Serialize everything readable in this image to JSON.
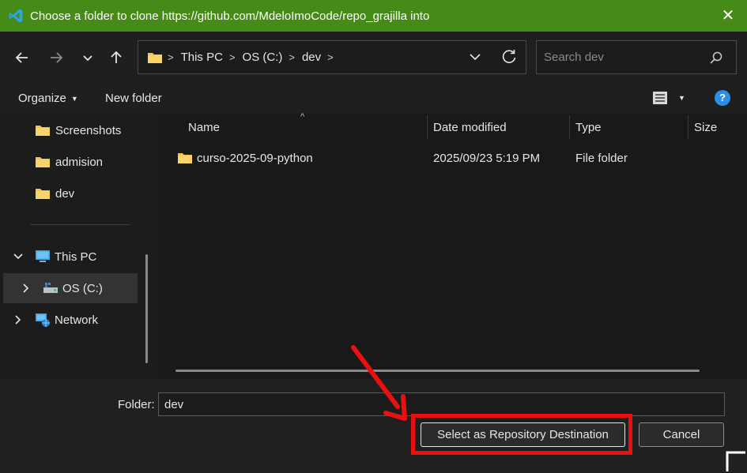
{
  "window": {
    "title": "Choose a folder to clone https://github.com/MdeloImoCode/repo_grajilla into",
    "titlebar_color": "#468a18",
    "app_icon": "vscode-icon",
    "close_glyph": "✕"
  },
  "nav": {
    "breadcrumbs": [
      "This PC",
      "OS (C:)",
      "dev"
    ],
    "search_placeholder": "Search dev"
  },
  "toolbar": {
    "organize_label": "Organize",
    "new_folder_label": "New folder"
  },
  "sidebar": {
    "quick_items": [
      {
        "label": "Screenshots",
        "icon": "folder-icon"
      },
      {
        "label": "admision",
        "icon": "folder-icon"
      },
      {
        "label": "dev",
        "icon": "folder-icon"
      }
    ],
    "this_pc_label": "This PC",
    "os_label": "OS (C:)",
    "network_label": "Network"
  },
  "columns": {
    "name": "Name",
    "date": "Date modified",
    "type": "Type",
    "size": "Size"
  },
  "files": [
    {
      "name": "curso-2025-09-python",
      "date": "2025/09/23 5:19 PM",
      "type": "File folder",
      "size": ""
    }
  ],
  "footer": {
    "folder_label": "Folder:",
    "folder_value": "dev",
    "select_button": "Select as Repository Destination",
    "cancel_button": "Cancel",
    "annotation_color": "#e81010"
  }
}
